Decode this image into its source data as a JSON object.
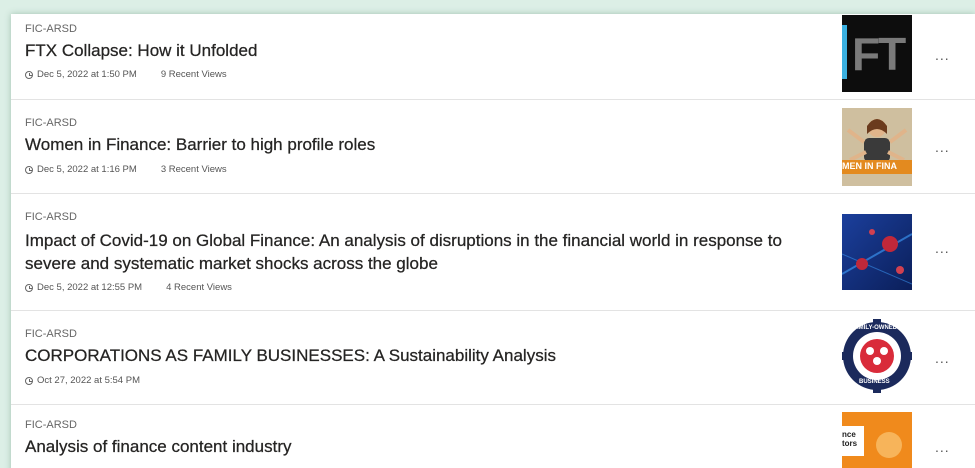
{
  "items": [
    {
      "site": "FIC-ARSD",
      "title": "FTX Collapse: How it Unfolded",
      "date": "Dec 5, 2022 at 1:50 PM",
      "views": "9 Recent Views",
      "thumb_icon": "ftx-logo-thumbnail",
      "thumb_text": "FT"
    },
    {
      "site": "FIC-ARSD",
      "title": "Women in Finance: Barrier to high profile roles",
      "date": "Dec 5, 2022 at 1:16 PM",
      "views": "3 Recent Views",
      "thumb_icon": "woman-finance-thumbnail",
      "thumb_text": "MEN IN FINA"
    },
    {
      "site": "FIC-ARSD",
      "title": "Impact of Covid-19 on Global Finance: An analysis of disruptions in the financial world in response to severe and systematic market shocks across the globe",
      "date": "Dec 5, 2022 at 12:55 PM",
      "views": "4 Recent Views",
      "thumb_icon": "virus-thumbnail"
    },
    {
      "site": "FIC-ARSD",
      "title": "CORPORATIONS AS FAMILY BUSINESSES: A Sustainability Analysis",
      "date": "Oct 27, 2022 at 5:54 PM",
      "thumb_icon": "family-owned-business-badge-thumbnail",
      "thumb_text_top": "FAMILY-OWNED",
      "thumb_text_bottom": "BUSINESS"
    },
    {
      "site": "FIC-ARSD",
      "title": "Analysis of finance content industry",
      "thumb_icon": "finance-creators-thumbnail",
      "thumb_text": "nce\ntors"
    }
  ],
  "more_label": "...",
  "colors": {
    "page_bg": "#dcefe6",
    "card_bg": "#ffffff",
    "title": "#252423"
  }
}
